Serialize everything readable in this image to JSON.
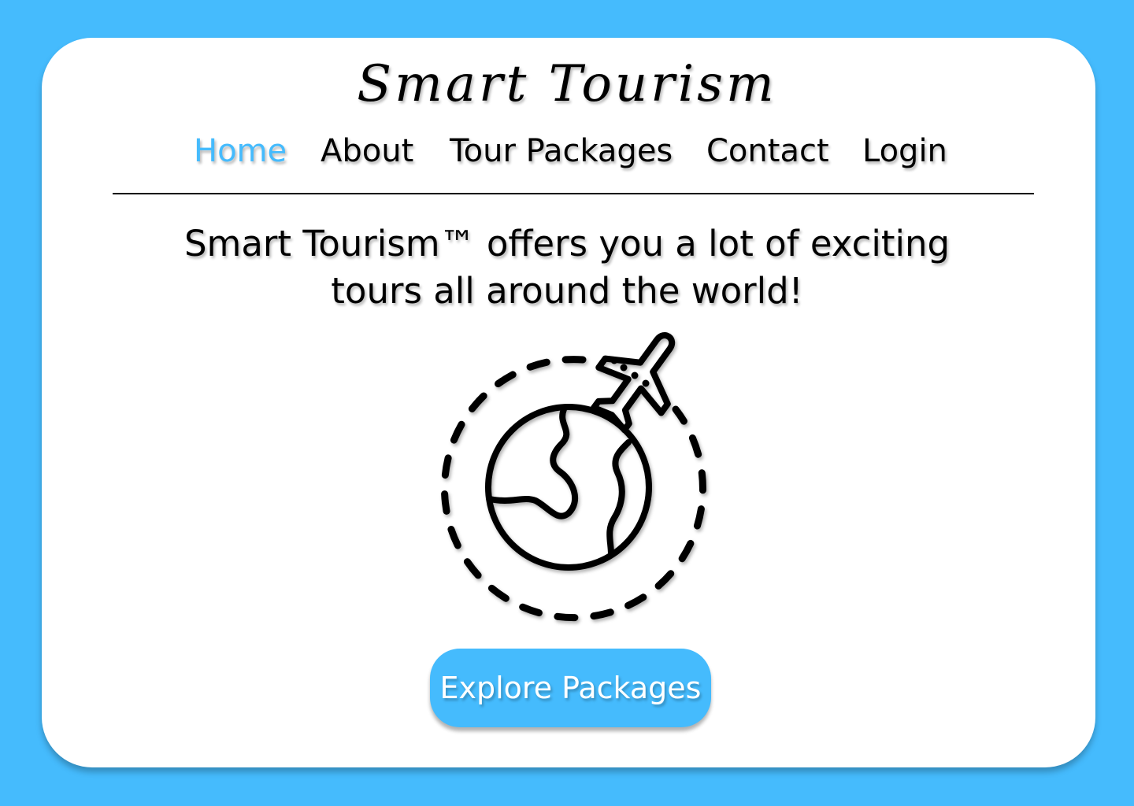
{
  "brand": {
    "title": "Smart Tourism"
  },
  "nav": {
    "items": [
      {
        "label": "Home",
        "active": true
      },
      {
        "label": "About",
        "active": false
      },
      {
        "label": "Tour Packages",
        "active": false
      },
      {
        "label": "Contact",
        "active": false
      },
      {
        "label": "Login",
        "active": false
      }
    ]
  },
  "hero": {
    "line1": "Smart Tourism™ offers you a lot of exciting",
    "line2": "tours all around the world!",
    "illustration_icon": "globe-airplane-icon",
    "cta_label": "Explore Packages"
  },
  "colors": {
    "background": "#45bbfd",
    "card": "#ffffff",
    "accent": "#45bbfd",
    "text": "#000000"
  }
}
